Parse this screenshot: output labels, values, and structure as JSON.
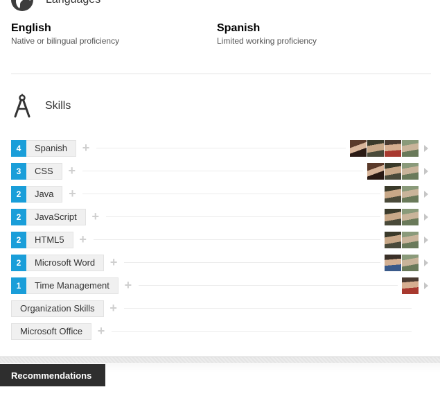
{
  "languages": {
    "title": "Languages",
    "items": [
      {
        "name": "English",
        "level": "Native or bilingual proficiency"
      },
      {
        "name": "Spanish",
        "level": "Limited working proficiency"
      }
    ]
  },
  "skills": {
    "title": "Skills",
    "items": [
      {
        "count": "4",
        "label": "Spanish",
        "avatars": [
          "woman-brown-hair",
          "man-dark-hair",
          "man-red-shirt",
          "man-outdoor"
        ]
      },
      {
        "count": "3",
        "label": "CSS",
        "avatars": [
          "woman-brown-hair",
          "man-dark-hair",
          "man-outdoor"
        ]
      },
      {
        "count": "2",
        "label": "Java",
        "avatars": [
          "man-dark-hair",
          "man-outdoor"
        ]
      },
      {
        "count": "2",
        "label": "JavaScript",
        "avatars": [
          "man-dark-hair",
          "man-outdoor"
        ]
      },
      {
        "count": "2",
        "label": "HTML5",
        "avatars": [
          "man-dark-hair",
          "man-outdoor"
        ]
      },
      {
        "count": "2",
        "label": "Microsoft Word",
        "avatars": [
          "man-blue-shirt",
          "man-outdoor"
        ]
      },
      {
        "count": "1",
        "label": "Time Management",
        "avatars": [
          "man-red-shirt"
        ]
      },
      {
        "count": "",
        "label": "Organization Skills",
        "avatars": []
      },
      {
        "count": "",
        "label": "Microsoft Office",
        "avatars": []
      }
    ]
  },
  "footer": {
    "tab_label": "Recommendations"
  },
  "icons": {
    "languages": "globe-icon",
    "skills": "compass-icon",
    "endorse": "plus-icon",
    "expand": "chevron-right-icon"
  },
  "colors": {
    "count_badge": "#1a9ed9",
    "pill_bg": "#f0f0f0",
    "footer_tab": "#2e2e2e"
  }
}
